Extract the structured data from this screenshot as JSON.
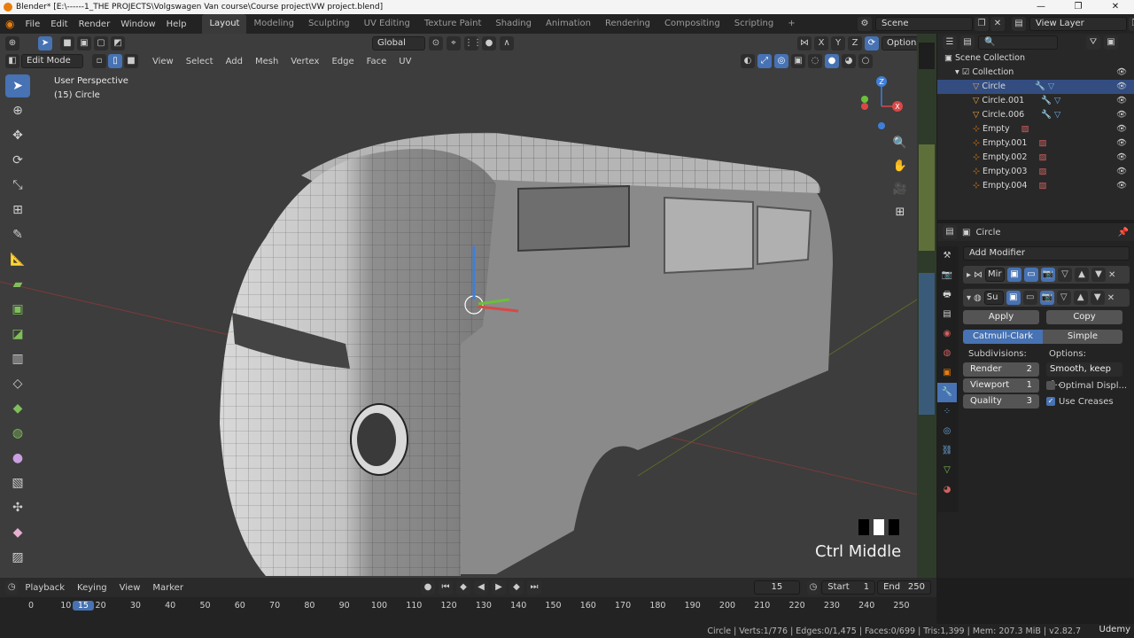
{
  "window": {
    "title": "Blender* [E:\\------1_THE PROJECTS\\Volgswagen Van course\\Course project\\VW project.blend]",
    "minimize": "—",
    "maximize": "❐",
    "close": "✕"
  },
  "menu": [
    "File",
    "Edit",
    "Render",
    "Window",
    "Help"
  ],
  "workspaces": [
    "Layout",
    "Modeling",
    "Sculpting",
    "UV Editing",
    "Texture Paint",
    "Shading",
    "Animation",
    "Rendering",
    "Compositing",
    "Scripting"
  ],
  "add_workspace": "+",
  "scene": {
    "label": "Scene",
    "view_layer": "View Layer"
  },
  "viewport_header": {
    "transform_orientation": "Global",
    "options": "Options",
    "axis": [
      "X",
      "Y",
      "Z"
    ],
    "mode": "Edit Mode",
    "menus": [
      "View",
      "Select",
      "Add",
      "Mesh",
      "Vertex",
      "Edge",
      "Face",
      "UV"
    ]
  },
  "viewport": {
    "perspective": "User Perspective",
    "object": "(15) Circle",
    "key_hint": "Ctrl Middle",
    "gizmo_axes": {
      "z": "Z",
      "x": "X"
    }
  },
  "outliner": {
    "root": "Scene Collection",
    "collection": "Collection",
    "items": [
      {
        "name": "Circle",
        "selected": true
      },
      {
        "name": "Circle.001",
        "selected": false
      },
      {
        "name": "Circle.006",
        "selected": false
      },
      {
        "name": "Empty",
        "selected": false
      },
      {
        "name": "Empty.001",
        "selected": false
      },
      {
        "name": "Empty.002",
        "selected": false
      },
      {
        "name": "Empty.003",
        "selected": false
      },
      {
        "name": "Empty.004",
        "selected": false
      }
    ]
  },
  "properties": {
    "object_name": "Circle",
    "add_modifier": "Add Modifier",
    "modifiers": [
      {
        "short": "Mir"
      },
      {
        "short": "Su"
      }
    ],
    "apply": "Apply",
    "copy": "Copy",
    "subdiv_types": [
      "Catmull-Clark",
      "Simple"
    ],
    "subdivisions_label": "Subdivisions:",
    "options_label": "Options:",
    "render_label": "Render",
    "render_value": "2",
    "viewport_label": "Viewport",
    "viewport_value": "1",
    "quality_label": "Quality",
    "quality_value": "3",
    "uv_smooth": "Smooth, keep c...",
    "optimal_display": "Optimal Displ...",
    "optimal_display_checked": false,
    "use_creases": "Use Creases",
    "use_creases_checked": true
  },
  "timeline": {
    "menus": [
      "Playback",
      "Keying",
      "View",
      "Marker"
    ],
    "current_frame": "15",
    "start_label": "Start",
    "start_value": "1",
    "end_label": "End",
    "end_value": "250",
    "ticks": [
      "0",
      "10",
      "15",
      "20",
      "30",
      "40",
      "50",
      "60",
      "70",
      "80",
      "90",
      "100",
      "110",
      "120",
      "130",
      "140",
      "150",
      "160",
      "170",
      "180",
      "190",
      "200",
      "210",
      "220",
      "230",
      "240",
      "250"
    ]
  },
  "status_bar": "Circle | Verts:1/776 | Edges:0/1,475 | Faces:0/699 | Tris:1,399 | Mem: 207.3 MiB | v2.82.7",
  "watermark": "Udemy",
  "colors": {
    "accent": "#4772b3",
    "selection": "#334d80",
    "orange": "#e87d0d"
  }
}
